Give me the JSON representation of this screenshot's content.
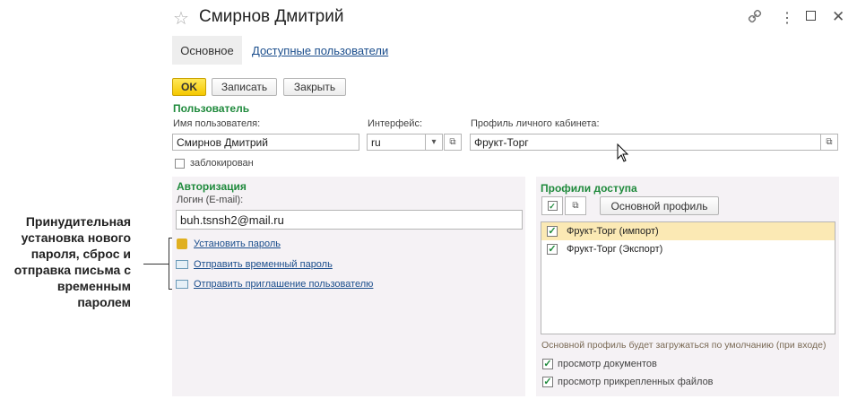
{
  "annotation": {
    "lines": [
      "Принудительная",
      "установка нового",
      "пароля, сброс и",
      "отправка письма с",
      "временным",
      "паролем"
    ]
  },
  "header": {
    "title": "Смирнов Дмитрий"
  },
  "tabs": [
    {
      "label": "Основное"
    },
    {
      "label": "Доступные пользователи"
    }
  ],
  "toolbar": {
    "ok": "OK",
    "save": "Записать",
    "close": "Закрыть"
  },
  "user": {
    "section": "Пользователь",
    "name_label": "Имя пользователя:",
    "name_value": "Смирнов Дмитрий",
    "interface_label": "Интерфейс:",
    "interface_value": "ru",
    "profile_label": "Профиль личного кабинета:",
    "profile_value": "Фрукт-Торг",
    "blocked_label": "заблокирован"
  },
  "auth": {
    "section": "Авторизация",
    "login_label": "Логин (E-mail):",
    "login_value": "buh.tsnsh2@mail.ru",
    "links": [
      "Установить пароль",
      "Отправить временный пароль",
      "Отправить приглашение пользователю"
    ]
  },
  "access": {
    "section": "Профили доступа",
    "main_profile_btn": "Основной профиль",
    "profiles": [
      "Фрукт-Торг (импорт)",
      "Фрукт-Торг (Экспорт)"
    ],
    "hint": "Основной профиль будет загружаться по умолчанию (при входе)",
    "view_docs": "просмотр документов",
    "view_files": "просмотр прикрепленных файлов"
  }
}
